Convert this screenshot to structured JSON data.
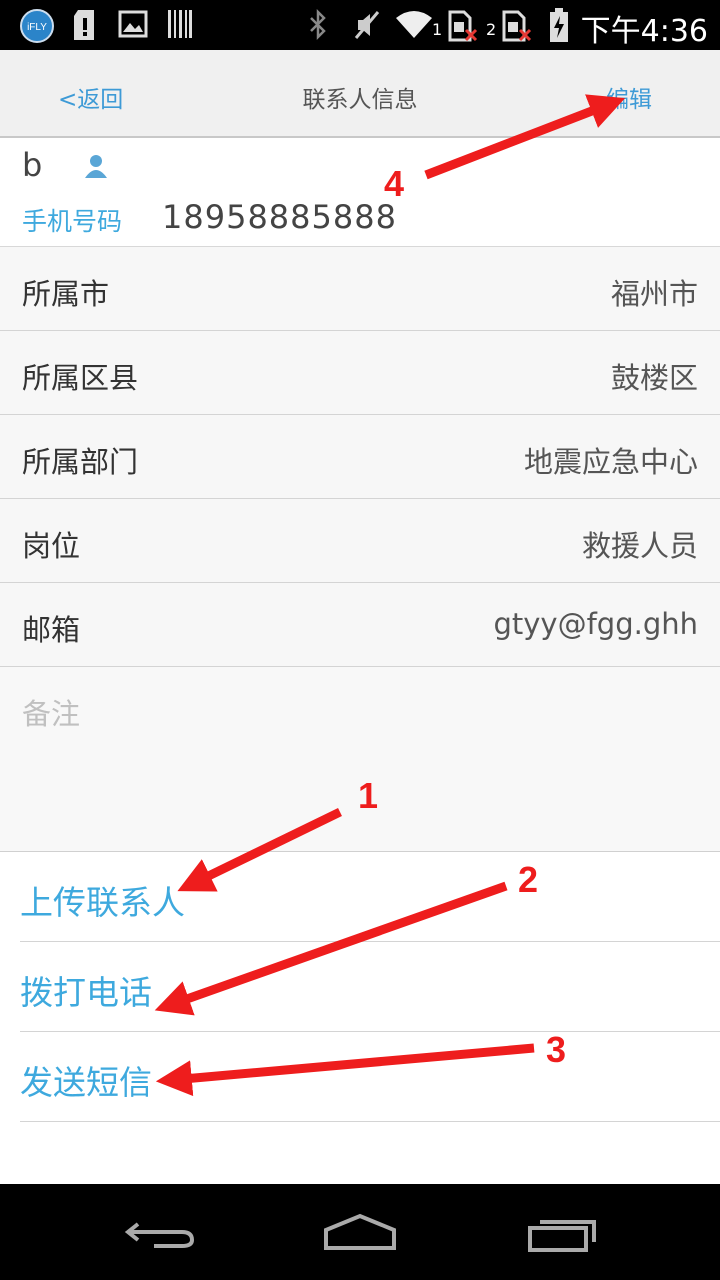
{
  "status_bar": {
    "time": "下午4:36",
    "sim1_num": "1",
    "sim2_num": "2",
    "app_icon_text": "iFLY",
    "icons": [
      "ifly-app-icon",
      "sd-card-icon",
      "image-icon",
      "barcode-icon",
      "bluetooth-icon",
      "mute-icon",
      "wifi-icon",
      "sim1-icon",
      "sim2-icon",
      "battery-icon"
    ]
  },
  "nav": {
    "back_label": "<返回",
    "title": "联系人信息",
    "edit_label": "编辑"
  },
  "contact": {
    "name": "b",
    "phone_label": "手机号码",
    "phone_value": "18958885888"
  },
  "fields": [
    {
      "label": "所属市",
      "value": "福州市"
    },
    {
      "label": "所属区县",
      "value": "鼓楼区"
    },
    {
      "label": "所属部门",
      "value": "地震应急中心"
    },
    {
      "label": "岗位",
      "value": "救援人员"
    },
    {
      "label": "邮箱",
      "value": "gtyy@fgg.ghh"
    }
  ],
  "note": {
    "placeholder": "备注"
  },
  "actions": [
    {
      "label": "上传联系人"
    },
    {
      "label": "拨打电话"
    },
    {
      "label": "发送短信"
    }
  ],
  "annotations": {
    "color": "#ee1d1d",
    "numbers": [
      "1",
      "2",
      "3",
      "4"
    ]
  },
  "nav_bar_icons": [
    "back-icon",
    "home-icon",
    "recent-apps-icon"
  ]
}
